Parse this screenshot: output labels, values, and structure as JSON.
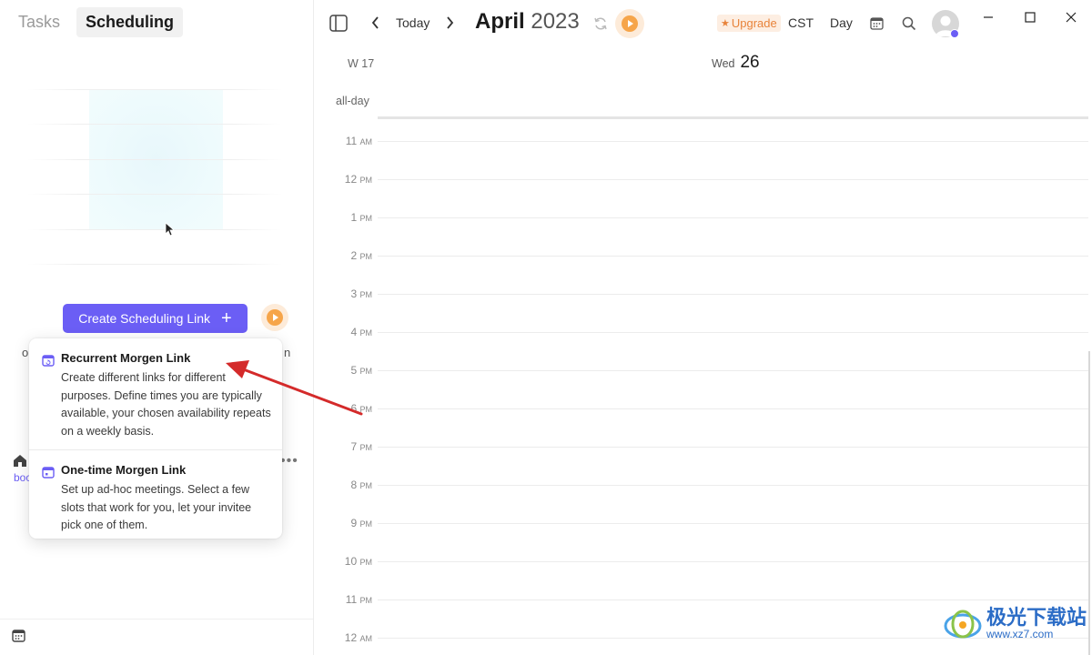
{
  "left_panel": {
    "tabs": [
      {
        "label": "Tasks",
        "active": false
      },
      {
        "label": "Scheduling",
        "active": true
      }
    ],
    "create_button_label": "Create Scheduling Link",
    "create_button_plus": "+",
    "peek_left_text": "o",
    "peek_right_text": "n",
    "peek_bottom_text": "boo",
    "more_icon_glyph": "•••"
  },
  "popup": {
    "items": [
      {
        "icon": "calendar-repeat-icon",
        "title": "Recurrent Morgen Link",
        "description": "Create different links for different purposes. Define times you are typically available, your chosen availability repeats on a weekly basis."
      },
      {
        "icon": "calendar-icon",
        "title": "One-time Morgen Link",
        "description": "Set up ad-hoc meetings. Select a few slots that work for you, let your invitee pick one of them."
      }
    ]
  },
  "toolbar": {
    "today_label": "Today",
    "month": "April",
    "year": "2023",
    "upgrade_label": "Upgrade",
    "upgrade_star": "★",
    "timezone": "CST",
    "view_label": "Day"
  },
  "calendar": {
    "week_label": "W 17",
    "day_name": "Wed",
    "day_number": "26",
    "allday_label": "all-day",
    "hours": [
      {
        "h": "11",
        "ap": "AM"
      },
      {
        "h": "12",
        "ap": "PM"
      },
      {
        "h": "1",
        "ap": "PM"
      },
      {
        "h": "2",
        "ap": "PM"
      },
      {
        "h": "3",
        "ap": "PM"
      },
      {
        "h": "4",
        "ap": "PM"
      },
      {
        "h": "5",
        "ap": "PM"
      },
      {
        "h": "6",
        "ap": "PM"
      },
      {
        "h": "7",
        "ap": "PM"
      },
      {
        "h": "8",
        "ap": "PM"
      },
      {
        "h": "9",
        "ap": "PM"
      },
      {
        "h": "10",
        "ap": "PM"
      },
      {
        "h": "11",
        "ap": "PM"
      },
      {
        "h": "12",
        "ap": "AM"
      }
    ]
  },
  "watermark": {
    "text": "极光下载站",
    "url": "www.xz7.com"
  },
  "colors": {
    "accent": "#6b5ef5",
    "upgrade_text": "#e8833a",
    "upgrade_bg": "#fdeee2",
    "annotation_arrow": "#d42a2a"
  }
}
